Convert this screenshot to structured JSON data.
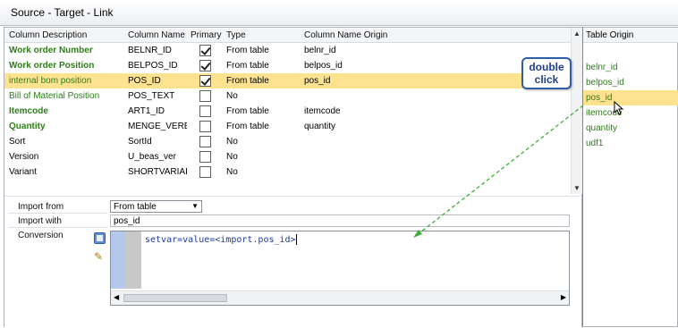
{
  "window": {
    "title": "Source - Target - Link"
  },
  "grid": {
    "columns": [
      "Column Description",
      "Column Name",
      "Primary",
      "Type",
      "Column Name Origin"
    ],
    "rows": [
      {
        "description": "Work order Number",
        "name": "BELNR_ID",
        "primary": true,
        "type": "From table",
        "origin": "belnr_id",
        "style": "bold"
      },
      {
        "description": "Work order Position",
        "name": "BELPOS_ID",
        "primary": true,
        "type": "From table",
        "origin": "belpos_id",
        "style": "bold"
      },
      {
        "description": "internal bom position",
        "name": "POS_ID",
        "primary": true,
        "type": "From table",
        "origin": "pos_id",
        "style": "green",
        "selected": true
      },
      {
        "description": "Bill of Material Position",
        "name": "POS_TEXT",
        "primary": false,
        "type": "No",
        "origin": "",
        "style": "green"
      },
      {
        "description": "Itemcode",
        "name": "ART1_ID",
        "primary": false,
        "type": "From table",
        "origin": "itemcode",
        "style": "bold"
      },
      {
        "description": "Quantity",
        "name": "MENGE_VERBI",
        "primary": false,
        "type": "From table",
        "origin": "quantity",
        "style": "bold"
      },
      {
        "description": "Sort",
        "name": "SortId",
        "primary": false,
        "type": "No",
        "origin": "",
        "style": "normal"
      },
      {
        "description": "Version",
        "name": "U_beas_ver",
        "primary": false,
        "type": "No",
        "origin": "",
        "style": "normal"
      },
      {
        "description": "Variant",
        "name": "SHORTVARIAI",
        "primary": false,
        "type": "No",
        "origin": "",
        "style": "normal"
      }
    ]
  },
  "form": {
    "import_from_label": "Import from",
    "import_from_value": "From table",
    "import_with_label": "Import with",
    "import_with_value": "pos_id",
    "conversion_label": "Conversion",
    "conversion_code": "setvar=value=<import.pos_id>"
  },
  "table_origin": {
    "header": "Table Origin",
    "items": [
      "belnr_id",
      "belpos_id",
      "pos_id",
      "itemcode",
      "quantity",
      "udf1"
    ],
    "selected_index": 2
  },
  "annotation": {
    "line1": "double",
    "line2": "click"
  },
  "colors": {
    "selection": "#fde38f",
    "green_text": "#2e7d1a",
    "arrow": "#3fae3a"
  },
  "icons": [
    "form-icon",
    "wand-icon",
    "checkmark-icon",
    "dropdown-arrow-icon",
    "mouse-cursor-icon"
  ]
}
